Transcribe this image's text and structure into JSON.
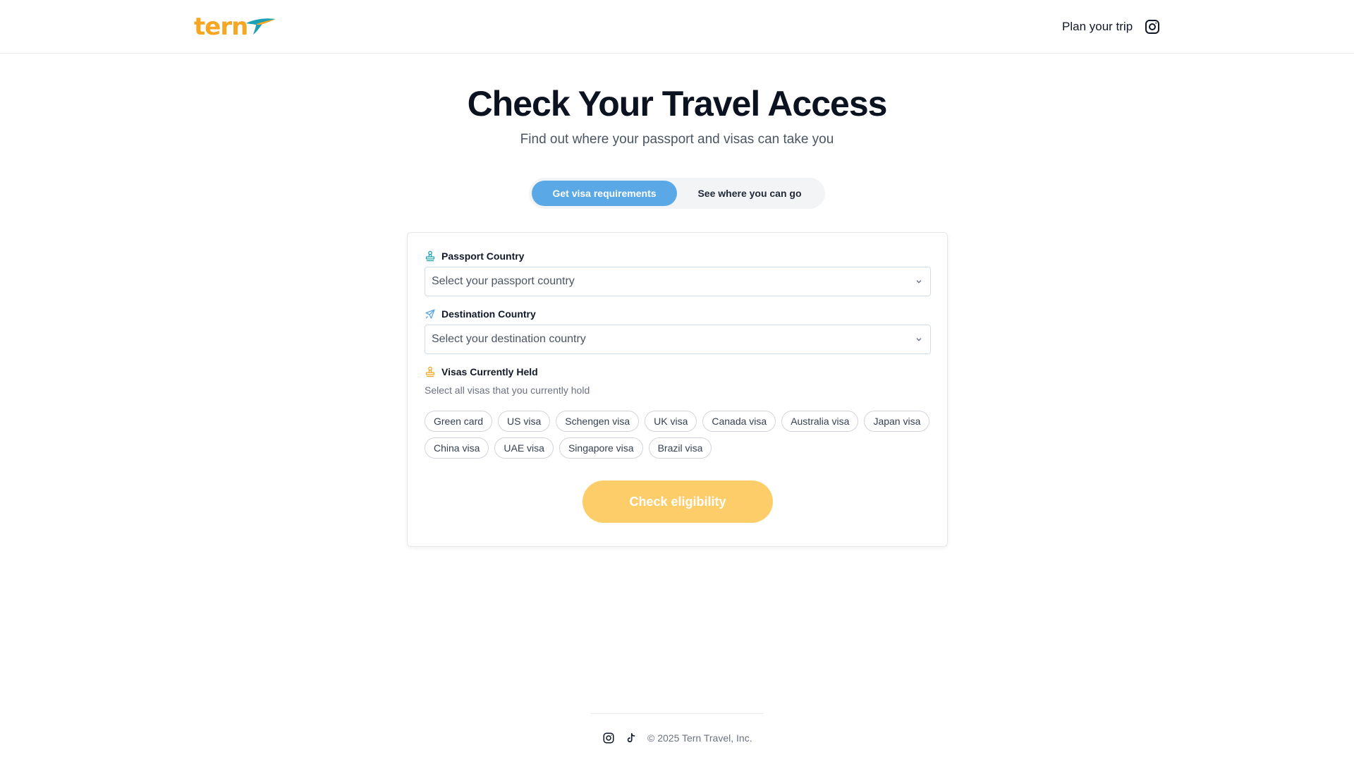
{
  "brand": {
    "name": "tern",
    "color": "#f5a623",
    "bird_color": "#1d9fb4",
    "icon": "tern-bird-logo"
  },
  "header": {
    "nav_link": "Plan your trip",
    "social_icon": "instagram-icon"
  },
  "hero": {
    "title": "Check Your Travel Access",
    "subtitle": "Find out where your passport and visas can take you"
  },
  "toggle": {
    "options": [
      {
        "label": "Get visa requirements",
        "active": true
      },
      {
        "label": "See where you can go",
        "active": false
      }
    ],
    "active_color": "#5aa9e6"
  },
  "form": {
    "passport": {
      "label": "Passport Country",
      "placeholder": "Select your passport country",
      "icon": "passport-stamp-icon"
    },
    "destination": {
      "label": "Destination Country",
      "placeholder": "Select your destination country",
      "icon": "airplane-icon"
    },
    "visas": {
      "label": "Visas Currently Held",
      "hint": "Select all visas that you currently hold",
      "icon": "visa-stamp-icon",
      "options": [
        "Green card",
        "US visa",
        "Schengen visa",
        "UK visa",
        "Canada visa",
        "Australia visa",
        "Japan visa",
        "China visa",
        "UAE visa",
        "Singapore visa",
        "Brazil visa"
      ]
    },
    "submit": {
      "label": "Check eligibility",
      "color": "#fdcd6a"
    }
  },
  "footer": {
    "copyright": "© 2025 Tern Travel, Inc.",
    "icons": [
      "instagram-icon",
      "tiktok-icon"
    ]
  }
}
